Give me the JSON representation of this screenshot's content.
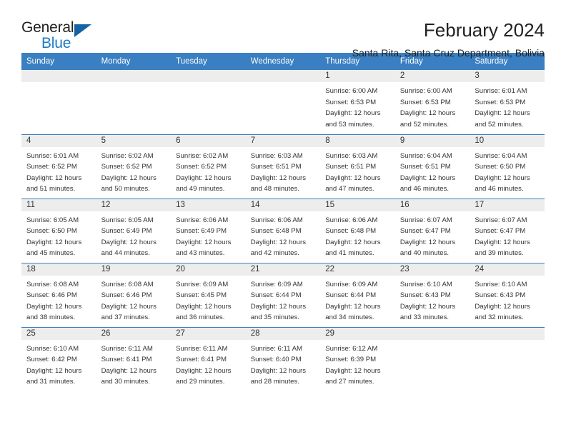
{
  "brand": {
    "name_part1": "General",
    "name_part2": "Blue",
    "triangle_icon": "triangle-icon",
    "accent_color": "#1a7bc9",
    "triangle_color": "#1464a5"
  },
  "header": {
    "title": "February 2024",
    "subtitle": "Santa Rita, Santa Cruz Department, Bolivia"
  },
  "theme": {
    "header_bg": "#3a7fc1",
    "daynum_bg": "#ededed",
    "grid_line": "#3a7fc1",
    "text": "#333333"
  },
  "weekday_headers": [
    "Sunday",
    "Monday",
    "Tuesday",
    "Wednesday",
    "Thursday",
    "Friday",
    "Saturday"
  ],
  "labels": {
    "sunrise_prefix": "Sunrise:",
    "sunset_prefix": "Sunset:",
    "daylight_prefix": "Daylight:"
  },
  "weeks": [
    [
      {
        "day": "",
        "empty": true
      },
      {
        "day": "",
        "empty": true
      },
      {
        "day": "",
        "empty": true
      },
      {
        "day": "",
        "empty": true
      },
      {
        "day": "1",
        "sunrise": "Sunrise: 6:00 AM",
        "sunset": "Sunset: 6:53 PM",
        "daylight": "Daylight: 12 hours and 53 minutes."
      },
      {
        "day": "2",
        "sunrise": "Sunrise: 6:00 AM",
        "sunset": "Sunset: 6:53 PM",
        "daylight": "Daylight: 12 hours and 52 minutes."
      },
      {
        "day": "3",
        "sunrise": "Sunrise: 6:01 AM",
        "sunset": "Sunset: 6:53 PM",
        "daylight": "Daylight: 12 hours and 52 minutes."
      }
    ],
    [
      {
        "day": "4",
        "sunrise": "Sunrise: 6:01 AM",
        "sunset": "Sunset: 6:52 PM",
        "daylight": "Daylight: 12 hours and 51 minutes."
      },
      {
        "day": "5",
        "sunrise": "Sunrise: 6:02 AM",
        "sunset": "Sunset: 6:52 PM",
        "daylight": "Daylight: 12 hours and 50 minutes."
      },
      {
        "day": "6",
        "sunrise": "Sunrise: 6:02 AM",
        "sunset": "Sunset: 6:52 PM",
        "daylight": "Daylight: 12 hours and 49 minutes."
      },
      {
        "day": "7",
        "sunrise": "Sunrise: 6:03 AM",
        "sunset": "Sunset: 6:51 PM",
        "daylight": "Daylight: 12 hours and 48 minutes."
      },
      {
        "day": "8",
        "sunrise": "Sunrise: 6:03 AM",
        "sunset": "Sunset: 6:51 PM",
        "daylight": "Daylight: 12 hours and 47 minutes."
      },
      {
        "day": "9",
        "sunrise": "Sunrise: 6:04 AM",
        "sunset": "Sunset: 6:51 PM",
        "daylight": "Daylight: 12 hours and 46 minutes."
      },
      {
        "day": "10",
        "sunrise": "Sunrise: 6:04 AM",
        "sunset": "Sunset: 6:50 PM",
        "daylight": "Daylight: 12 hours and 46 minutes."
      }
    ],
    [
      {
        "day": "11",
        "sunrise": "Sunrise: 6:05 AM",
        "sunset": "Sunset: 6:50 PM",
        "daylight": "Daylight: 12 hours and 45 minutes."
      },
      {
        "day": "12",
        "sunrise": "Sunrise: 6:05 AM",
        "sunset": "Sunset: 6:49 PM",
        "daylight": "Daylight: 12 hours and 44 minutes."
      },
      {
        "day": "13",
        "sunrise": "Sunrise: 6:06 AM",
        "sunset": "Sunset: 6:49 PM",
        "daylight": "Daylight: 12 hours and 43 minutes."
      },
      {
        "day": "14",
        "sunrise": "Sunrise: 6:06 AM",
        "sunset": "Sunset: 6:48 PM",
        "daylight": "Daylight: 12 hours and 42 minutes."
      },
      {
        "day": "15",
        "sunrise": "Sunrise: 6:06 AM",
        "sunset": "Sunset: 6:48 PM",
        "daylight": "Daylight: 12 hours and 41 minutes."
      },
      {
        "day": "16",
        "sunrise": "Sunrise: 6:07 AM",
        "sunset": "Sunset: 6:47 PM",
        "daylight": "Daylight: 12 hours and 40 minutes."
      },
      {
        "day": "17",
        "sunrise": "Sunrise: 6:07 AM",
        "sunset": "Sunset: 6:47 PM",
        "daylight": "Daylight: 12 hours and 39 minutes."
      }
    ],
    [
      {
        "day": "18",
        "sunrise": "Sunrise: 6:08 AM",
        "sunset": "Sunset: 6:46 PM",
        "daylight": "Daylight: 12 hours and 38 minutes."
      },
      {
        "day": "19",
        "sunrise": "Sunrise: 6:08 AM",
        "sunset": "Sunset: 6:46 PM",
        "daylight": "Daylight: 12 hours and 37 minutes."
      },
      {
        "day": "20",
        "sunrise": "Sunrise: 6:09 AM",
        "sunset": "Sunset: 6:45 PM",
        "daylight": "Daylight: 12 hours and 36 minutes."
      },
      {
        "day": "21",
        "sunrise": "Sunrise: 6:09 AM",
        "sunset": "Sunset: 6:44 PM",
        "daylight": "Daylight: 12 hours and 35 minutes."
      },
      {
        "day": "22",
        "sunrise": "Sunrise: 6:09 AM",
        "sunset": "Sunset: 6:44 PM",
        "daylight": "Daylight: 12 hours and 34 minutes."
      },
      {
        "day": "23",
        "sunrise": "Sunrise: 6:10 AM",
        "sunset": "Sunset: 6:43 PM",
        "daylight": "Daylight: 12 hours and 33 minutes."
      },
      {
        "day": "24",
        "sunrise": "Sunrise: 6:10 AM",
        "sunset": "Sunset: 6:43 PM",
        "daylight": "Daylight: 12 hours and 32 minutes."
      }
    ],
    [
      {
        "day": "25",
        "sunrise": "Sunrise: 6:10 AM",
        "sunset": "Sunset: 6:42 PM",
        "daylight": "Daylight: 12 hours and 31 minutes."
      },
      {
        "day": "26",
        "sunrise": "Sunrise: 6:11 AM",
        "sunset": "Sunset: 6:41 PM",
        "daylight": "Daylight: 12 hours and 30 minutes."
      },
      {
        "day": "27",
        "sunrise": "Sunrise: 6:11 AM",
        "sunset": "Sunset: 6:41 PM",
        "daylight": "Daylight: 12 hours and 29 minutes."
      },
      {
        "day": "28",
        "sunrise": "Sunrise: 6:11 AM",
        "sunset": "Sunset: 6:40 PM",
        "daylight": "Daylight: 12 hours and 28 minutes."
      },
      {
        "day": "29",
        "sunrise": "Sunrise: 6:12 AM",
        "sunset": "Sunset: 6:39 PM",
        "daylight": "Daylight: 12 hours and 27 minutes."
      },
      {
        "day": "",
        "empty": true
      },
      {
        "day": "",
        "empty": true
      }
    ]
  ]
}
